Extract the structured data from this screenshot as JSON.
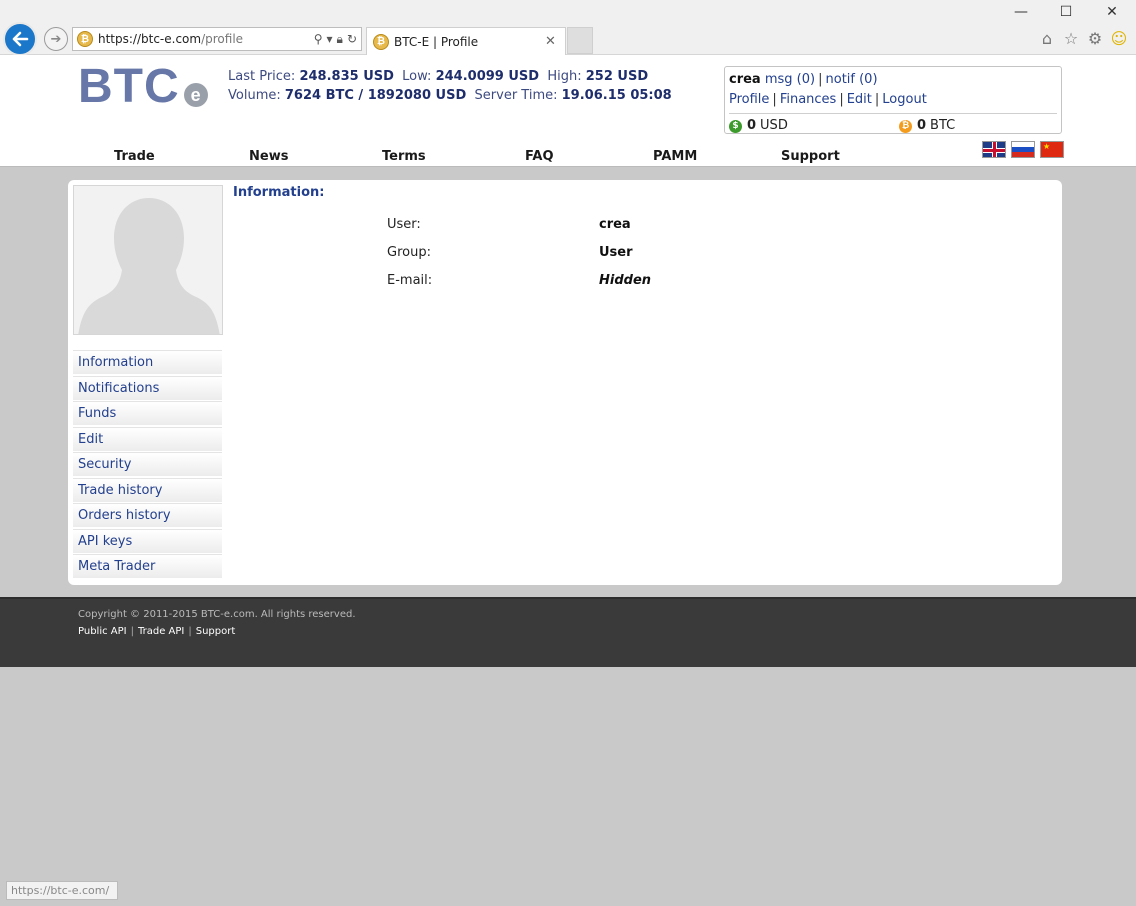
{
  "browser": {
    "address": "https://btc-e.com/profile",
    "address_host": "https://btc-e.com",
    "address_path": "/profile",
    "tab_title": "BTC-E | Profile",
    "status_url": "https://btc-e.com/"
  },
  "header": {
    "logo_text": "BTC",
    "logo_suffix": "e",
    "stats": {
      "last_price_label": "Last Price:",
      "last_price": "248.835 USD",
      "low_label": "Low:",
      "low": "244.0099 USD",
      "high_label": "High:",
      "high": "252 USD",
      "volume_label": "Volume:",
      "volume": "7624 BTC / 1892080 USD",
      "server_time_label": "Server Time:",
      "server_time": "19.06.15 05:08"
    },
    "user": {
      "name": "crea",
      "msg": "msg (0)",
      "notif": "notif (0)",
      "links": [
        "Profile",
        "Finances",
        "Edit",
        "Logout"
      ],
      "usd_amount": "0",
      "usd_label": "USD",
      "btc_amount": "0",
      "btc_label": "BTC"
    },
    "nav": [
      "Trade",
      "News",
      "Terms",
      "FAQ",
      "PAMM",
      "Support"
    ]
  },
  "sidebar": {
    "items": [
      "Information",
      "Notifications",
      "Funds",
      "Edit",
      "Security",
      "Trade history",
      "Orders history",
      "API keys",
      "Meta Trader"
    ]
  },
  "info": {
    "title": "Information:",
    "rows": [
      {
        "label": "User:",
        "value": "crea"
      },
      {
        "label": "Group:",
        "value": "User"
      },
      {
        "label": "E-mail:",
        "value": "Hidden"
      }
    ]
  },
  "footer": {
    "copyright": "Copyright © 2011-2015 BTC-e.com. All rights reserved.",
    "links": [
      "Public API",
      "Trade API",
      "Support"
    ]
  },
  "colors": {
    "link": "#23408e",
    "logo": "#6677a8",
    "footer_bg": "#3a3a3a",
    "page_bg": "#c9c9c9"
  }
}
